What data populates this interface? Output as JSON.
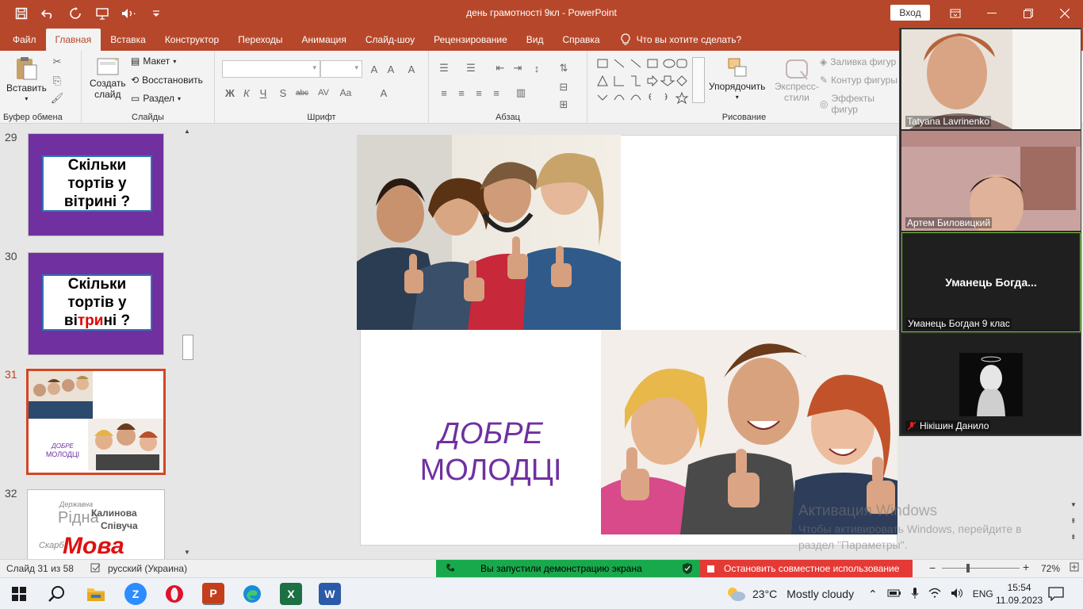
{
  "window": {
    "title": "день грамотності 9кл  -  PowerPoint",
    "signin_label": "Вход",
    "accent": "#b7472a"
  },
  "qat": [
    "save-icon",
    "undo-icon",
    "redo-icon",
    "slideshow-icon",
    "speaker-icon",
    "customize-icon"
  ],
  "tabs": [
    "Файл",
    "Главная",
    "Вставка",
    "Конструктор",
    "Переходы",
    "Анимация",
    "Слайд-шоу",
    "Рецензирование",
    "Вид",
    "Справка"
  ],
  "active_tab": "Главная",
  "tell_me": "Что вы хотите сделать?",
  "ribbon": {
    "clipboard": {
      "paste": "Вставить",
      "label": "Буфер обмена"
    },
    "slides": {
      "new_slide_1": "Создать",
      "new_slide_2": "слайд",
      "layout": "Макет",
      "reset": "Восстановить",
      "section": "Раздел",
      "label": "Слайды"
    },
    "font": {
      "bold": "Ж",
      "italic": "К",
      "underline": "Ч",
      "shadow": "S",
      "strike": "abc",
      "spacing": "AV",
      "case": "Aa",
      "label": "Шрифт"
    },
    "paragraph": {
      "label": "Абзац"
    },
    "drawing": {
      "arrange": "Упорядочить",
      "quick_styles_1": "Экспресс-",
      "quick_styles_2": "стили",
      "fill": "Заливка фигур",
      "outline": "Контур фигуры",
      "effects": "Эффекты фигур",
      "label": "Рисование"
    }
  },
  "thumbnails": [
    {
      "num": "29",
      "lines": [
        "Скільки",
        "тортів у",
        "вітрині ?"
      ]
    },
    {
      "num": "30",
      "line1": "Скільки",
      "line2": "тортів у",
      "line3_a": "ві",
      "line3_b": "три",
      "line3_c": "ні ?"
    },
    {
      "num": "31",
      "text1": "ДОБРЕ",
      "text2": "МОЛОДЦІ"
    },
    {
      "num": "32",
      "words": [
        "Державна",
        "Рідна",
        "Калинова",
        "Співуча",
        "Мова",
        "Скарб"
      ]
    }
  ],
  "slide": {
    "line1": "ДОБРЕ",
    "line2": "МОЛОДЦІ",
    "text_color": "#7030a0"
  },
  "watermark": {
    "title": "Активация Windows",
    "line1": "Чтобы активировать Windows, перейдите в",
    "line2": "раздел \"Параметры\"."
  },
  "participants": [
    {
      "name": "Tatyana Lavrinenko"
    },
    {
      "name": "Артем Биловицкий"
    },
    {
      "name": "Уманець Богдан 9 клас",
      "center": "Уманець  Богда..."
    },
    {
      "name": "Нікішин Данило"
    }
  ],
  "status": {
    "slide_count": "Слайд 31 из 58",
    "language": "русский (Украина)",
    "share_msg": "Вы запустили демонстрацию экрана",
    "stop_share": "Остановить совместное использование",
    "zoom": "72%"
  },
  "taskbar": {
    "weather_temp": "23°C",
    "weather_desc": "Mostly cloudy",
    "lang": "ENG",
    "time": "15:54",
    "date": "11.09.2023"
  }
}
